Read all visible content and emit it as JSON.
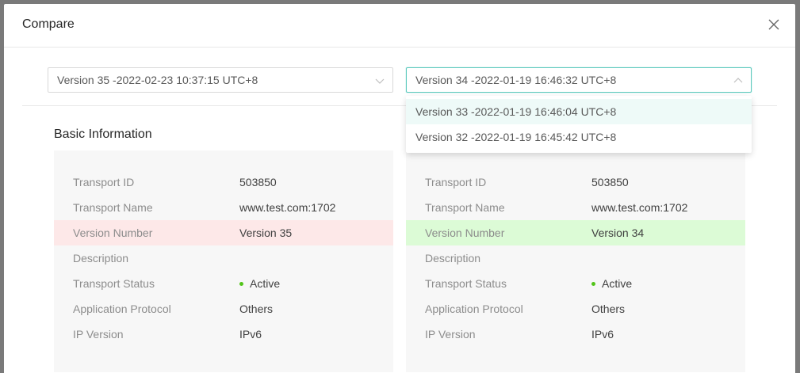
{
  "modal": {
    "title": "Compare"
  },
  "selects": {
    "left": {
      "value": "Version 35 -2022-02-23 10:37:15 UTC+8"
    },
    "right": {
      "value": "Version 34 -2022-01-19 16:46:32 UTC+8"
    }
  },
  "dropdown": {
    "options": [
      "Version 33 -2022-01-19 16:46:04 UTC+8",
      "Version 32 -2022-01-19 16:45:42 UTC+8"
    ]
  },
  "section": {
    "title": "Basic Information"
  },
  "left_panel": {
    "rows": [
      {
        "label": "Transport ID",
        "value": "503850"
      },
      {
        "label": "Transport Name",
        "value": "www.test.com:1702"
      },
      {
        "label": "Version Number",
        "value": "Version 35"
      },
      {
        "label": "Description",
        "value": ""
      },
      {
        "label": "Transport Status",
        "value": "Active"
      },
      {
        "label": "Application Protocol",
        "value": "Others"
      },
      {
        "label": "IP Version",
        "value": "IPv6"
      }
    ]
  },
  "right_panel": {
    "rows": [
      {
        "label": "Transport ID",
        "value": "503850"
      },
      {
        "label": "Transport Name",
        "value": "www.test.com:1702"
      },
      {
        "label": "Version Number",
        "value": "Version 34"
      },
      {
        "label": "Description",
        "value": ""
      },
      {
        "label": "Transport Status",
        "value": "Active"
      },
      {
        "label": "Application Protocol",
        "value": "Others"
      },
      {
        "label": "IP Version",
        "value": "IPv6"
      }
    ]
  },
  "colors": {
    "diff_removed": "#fde8e8",
    "diff_added": "#dcfbd6",
    "status_active": "#52c41a",
    "focus_border": "#5cc9bd"
  },
  "icons": {
    "close": "close-icon",
    "chevron_down": "chevron-down-icon",
    "chevron_up": "chevron-up-icon",
    "status_dot": "status-dot-icon"
  }
}
